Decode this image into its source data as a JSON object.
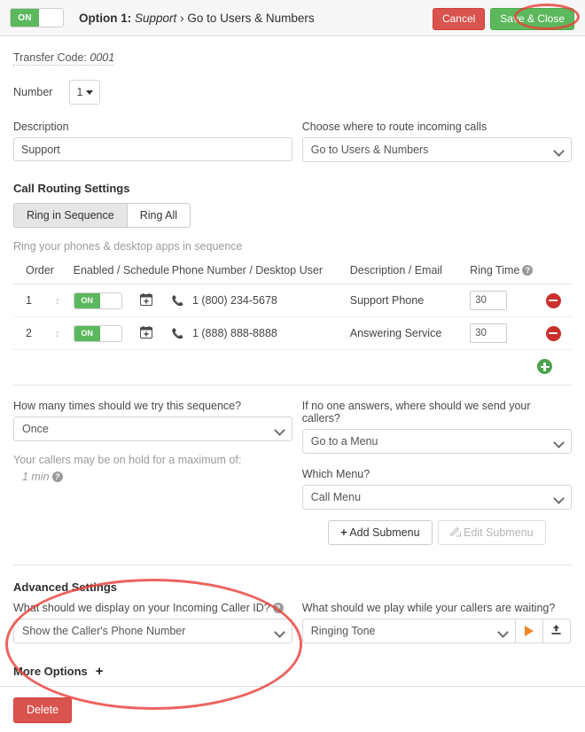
{
  "header": {
    "toggle_label": "ON",
    "title_prefix": "Option 1:",
    "title_name": "Support",
    "title_sep": "›",
    "title_target": "Go to Users & Numbers",
    "cancel_label": "Cancel",
    "save_label": "Save & Close"
  },
  "transfer": {
    "label": "Transfer Code:",
    "code": "0001"
  },
  "number": {
    "label": "Number",
    "value": "1"
  },
  "description": {
    "label": "Description",
    "value": "Support",
    "placeholder": "Description"
  },
  "route": {
    "label": "Choose where to route incoming calls",
    "value": "Go to Users & Numbers"
  },
  "call_routing": {
    "heading": "Call Routing Settings",
    "tabs": [
      {
        "label": "Ring in Sequence",
        "active": true
      },
      {
        "label": "Ring All",
        "active": false
      }
    ],
    "hint": "Ring your phones & desktop apps in sequence",
    "columns": [
      "Order",
      "Enabled / Schedule",
      "Phone Number / Desktop User",
      "Description / Email",
      "Ring Time"
    ],
    "ring_time_help": "?",
    "rows": [
      {
        "order": "1",
        "enabled_label": "ON",
        "phone": "1 (800) 234-5678",
        "description": "Support Phone",
        "ring_time": "30"
      },
      {
        "order": "2",
        "enabled_label": "ON",
        "phone": "1 (888) 888-8888",
        "description": "Answering Service",
        "ring_time": "30"
      }
    ]
  },
  "retries": {
    "label": "How many times should we try this sequence?",
    "value": "Once"
  },
  "hold": {
    "label": "Your callers may be on hold for a maximum of:",
    "value": "1 min",
    "help": "?"
  },
  "no_answer": {
    "label": "If no one answers, where should we send your callers?",
    "value": "Go to a Menu"
  },
  "which_menu": {
    "label": "Which Menu?",
    "value": "Call Menu",
    "add_label": "Add Submenu",
    "add_icon": "+",
    "edit_label": "Edit Submenu"
  },
  "advanced": {
    "heading": "Advanced Settings",
    "caller_id_label": "What should we display on your Incoming Caller ID?",
    "caller_id_help": "?",
    "caller_id_value": "Show the Caller's Phone Number",
    "waiting_label": "What should we play while your callers are waiting?",
    "waiting_value": "Ringing Tone"
  },
  "more_options": {
    "label": "More Options",
    "icon": "+"
  },
  "footer": {
    "delete_label": "Delete"
  },
  "colors": {
    "green": "#5cb85c",
    "red": "#d9534f",
    "orange": "#f0862a",
    "annotation": "#e8413c"
  }
}
